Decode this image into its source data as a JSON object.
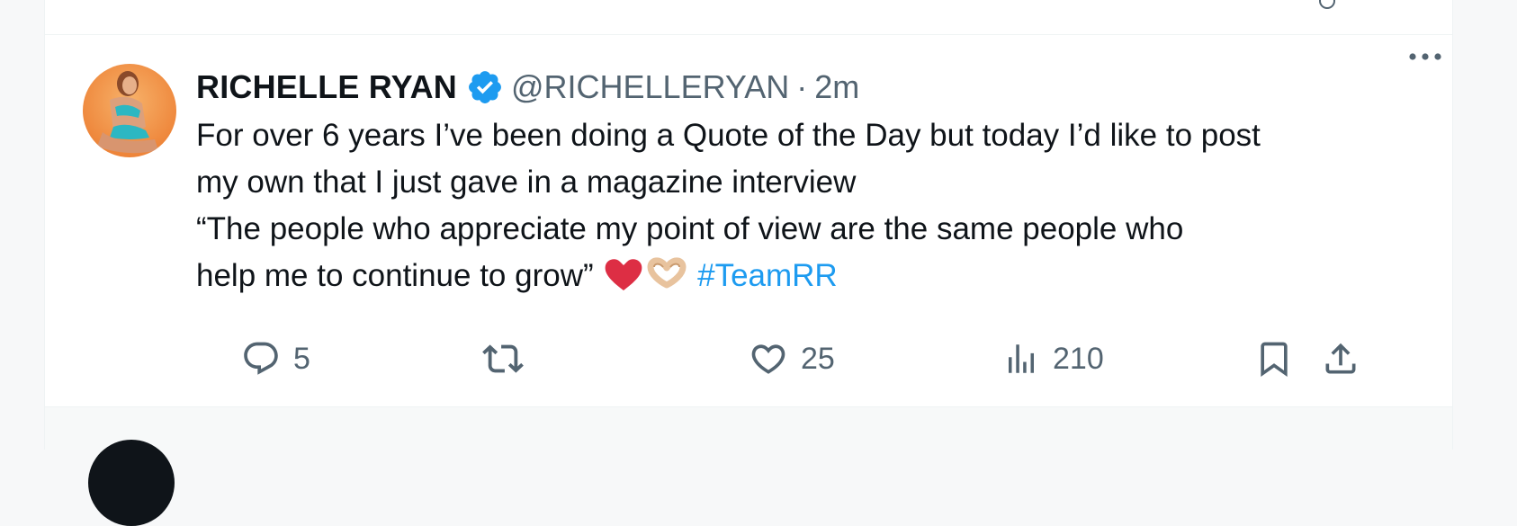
{
  "tweet": {
    "author_name": "RICHELLE RYAN",
    "handle": "@RICHELLERYAN",
    "separator": "·",
    "time": "2m",
    "text_lines": [
      "For over 6 years I’ve been doing a Quote of the Day but today I’d like to post",
      "my own that I just gave in a magazine interview",
      "“The people who appreciate my point of view are the same people who"
    ],
    "last_line_text": "help me to continue to grow”",
    "emojis": [
      "red-heart-emoji",
      "heart-hands-emoji"
    ],
    "hashtag": "#TeamRR",
    "actions": {
      "reply_count": "5",
      "repost_count": "",
      "like_count": "25",
      "views_count": "210"
    },
    "icons": [
      "verified-badge-icon",
      "more-icon",
      "reply-icon",
      "repost-icon",
      "like-icon",
      "views-icon",
      "bookmark-icon",
      "share-icon"
    ]
  },
  "colors": {
    "accent": "#1d9bf0",
    "secondary_text": "#536471",
    "primary_text": "#0f1419",
    "heart": "#e0245e"
  }
}
